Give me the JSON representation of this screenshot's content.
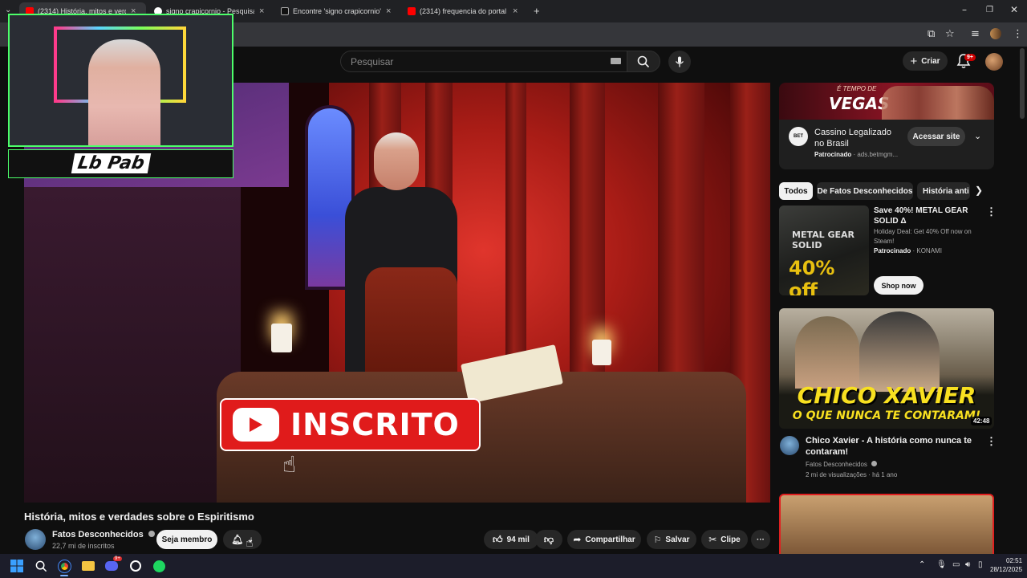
{
  "browser": {
    "tabs": [
      {
        "title": "(2314) História, mitos e verdades",
        "favicon_color": "#ff0000"
      },
      {
        "title": "signo crapicornio - Pesquisa Go",
        "favicon_color": "#ffffff"
      },
      {
        "title": "Encontre 'signo crapicornio' no",
        "favicon_color": "#111111"
      },
      {
        "title": "(2314) frequencia do portal de",
        "favicon_color": "#ff0000"
      }
    ],
    "new_tab": "+"
  },
  "header": {
    "search_placeholder": "Pesquisar",
    "create_label": "Criar",
    "notifications_badge": "9+"
  },
  "overlay": {
    "subscribe_text": "INSCRITO",
    "streamer_tag": "Lb Pab"
  },
  "video": {
    "title": "História, mitos e verdades sobre o Espiritismo",
    "channel": "Fatos Desconhecidos",
    "subscribers": "22,7 mi de inscritos",
    "member_label": "Seja membro",
    "likes": "94 mil",
    "share_label": "Compartilhar",
    "save_label": "Salvar",
    "clip_label": "Clipe"
  },
  "sidebar": {
    "ad": {
      "banner_top": "É TEMPO DE",
      "banner_title": "VEGAS",
      "logo_text": "BET",
      "title": "Cassino Legalizado no Brasil",
      "sponsored": "Patrocinado",
      "domain": "ads.betmgm...",
      "cta": "Acessar site"
    },
    "chips": [
      "Todos",
      "De Fatos Desconhecidos",
      "História anti"
    ],
    "promo": {
      "thumb_title": "METAL GEAR SOLID",
      "thumb_sale": "40% off",
      "title": "Save 40%! METAL GEAR SOLID Δ",
      "description": "Holiday Deal: Get 40% Off now on Steam!",
      "sponsored": "Patrocinado",
      "advertiser": "KONAMI",
      "cta": "Shop now"
    },
    "recommendations": [
      {
        "thumb_line1": "CHICO XAVIER",
        "thumb_line2": "O QUE NUNCA TE CONTARAM!",
        "duration": "42:48",
        "title": "Chico Xavier - A história como nunca te contaram!",
        "channel": "Fatos Desconhecidos",
        "meta": "2 mi de visualizações · há 1 ano"
      }
    ]
  },
  "taskbar": {
    "badge": "9+",
    "time": "02:51",
    "date": "28/12/2025"
  }
}
